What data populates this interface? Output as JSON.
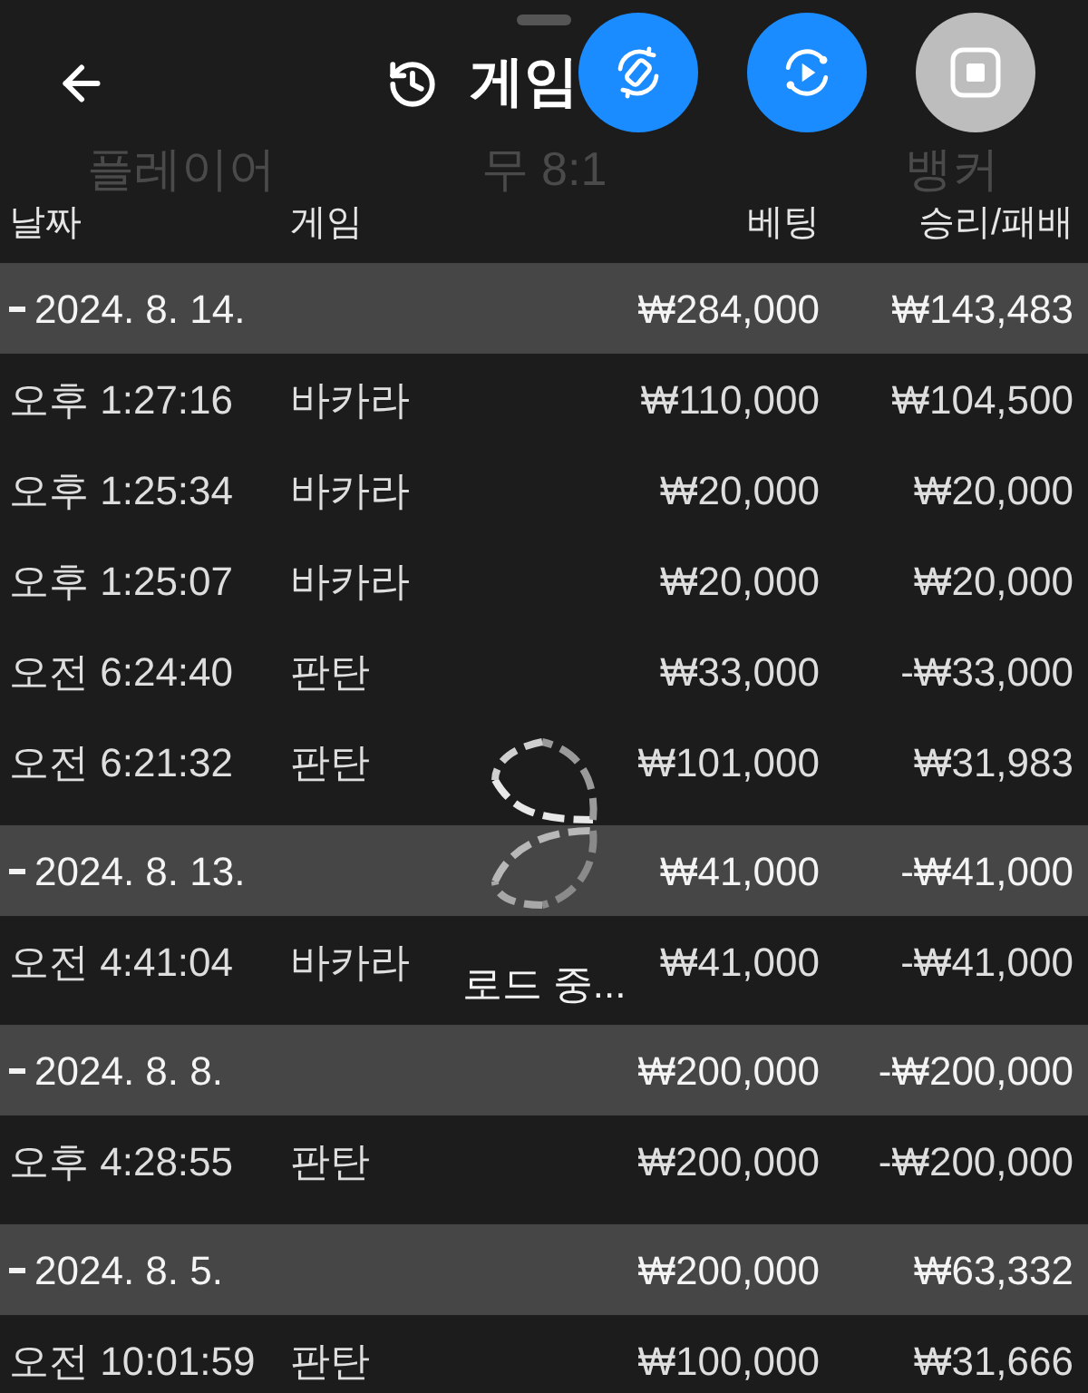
{
  "sheet": {
    "title": "게임"
  },
  "floating_controls": [
    {
      "kind": "rotate"
    },
    {
      "kind": "replay"
    },
    {
      "kind": "stop"
    }
  ],
  "background_labels": [
    "플레이어",
    "무 8:1",
    "뱅커"
  ],
  "table": {
    "columns": [
      "날짜",
      "게임",
      "베팅",
      "승리/패배"
    ],
    "groups": [
      {
        "date": "2024. 8. 14.",
        "expanded": true,
        "bet": "₩284,000",
        "result": "₩143,483",
        "rows": [
          {
            "time": "오후 1:27:16",
            "game": "바카라",
            "bet": "₩110,000",
            "result": "₩104,500"
          },
          {
            "time": "오후 1:25:34",
            "game": "바카라",
            "bet": "₩20,000",
            "result": "₩20,000"
          },
          {
            "time": "오후 1:25:07",
            "game": "바카라",
            "bet": "₩20,000",
            "result": "₩20,000"
          },
          {
            "time": "오전 6:24:40",
            "game": "판탄",
            "bet": "₩33,000",
            "result": "-₩33,000"
          },
          {
            "time": "오전 6:21:32",
            "game": "판탄",
            "bet": "₩101,000",
            "result": "₩31,983"
          }
        ]
      },
      {
        "date": "2024. 8. 13.",
        "expanded": true,
        "bet": "₩41,000",
        "result": "-₩41,000",
        "rows": [
          {
            "time": "오전 4:41:04",
            "game": "바카라",
            "bet": "₩41,000",
            "result": "-₩41,000"
          }
        ]
      },
      {
        "date": "2024. 8. 8.",
        "expanded": true,
        "bet": "₩200,000",
        "result": "-₩200,000",
        "rows": [
          {
            "time": "오후 4:28:55",
            "game": "판탄",
            "bet": "₩200,000",
            "result": "-₩200,000"
          }
        ]
      },
      {
        "date": "2024. 8. 5.",
        "expanded": true,
        "bet": "₩200,000",
        "result": "₩63,332",
        "rows": [
          {
            "time": "오전 10:01:59",
            "game": "판탄",
            "bet": "₩100,000",
            "result": "₩31,666"
          }
        ]
      }
    ]
  },
  "loading": {
    "text": "로드 중..."
  }
}
